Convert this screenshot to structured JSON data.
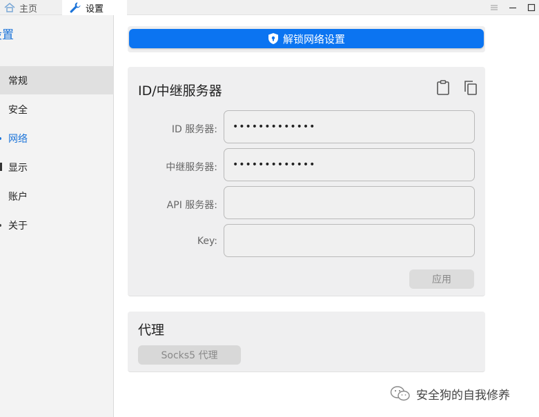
{
  "titlebar": {
    "tabs": [
      {
        "label": "主页",
        "icon": "home-icon"
      },
      {
        "label": "设置",
        "icon": "wrench-icon"
      }
    ],
    "controls": [
      "menu-icon",
      "minimize-icon",
      "maximize-icon"
    ]
  },
  "sidebar": {
    "title": "设置",
    "items": [
      {
        "label": "常规"
      },
      {
        "label": "安全"
      },
      {
        "label": "网络"
      },
      {
        "label": "显示"
      },
      {
        "label": "账户"
      },
      {
        "label": "关于"
      }
    ]
  },
  "main": {
    "unlock_label": "解锁网络设置",
    "id_card": {
      "title": "ID/中继服务器",
      "icons": [
        "clipboard-icon",
        "copy-icon"
      ],
      "fields": [
        {
          "label": "ID 服务器:",
          "value": "•••••••••••••"
        },
        {
          "label": "中继服务器:",
          "value": "•••••••••••••"
        },
        {
          "label": "API 服务器:",
          "value": ""
        },
        {
          "label": "Key:",
          "value": ""
        }
      ],
      "apply_label": "应用"
    },
    "proxy_card": {
      "title": "代理",
      "socks_label": "Socks5 代理"
    }
  },
  "watermark": {
    "text": "安全狗的自我修养",
    "icon": "wechat-icon"
  },
  "colors": {
    "accent": "#1a73d9",
    "unlock_button": "#0b74f1",
    "sidebar_bg": "#f3f3f3",
    "card_bg": "#efeff0"
  }
}
